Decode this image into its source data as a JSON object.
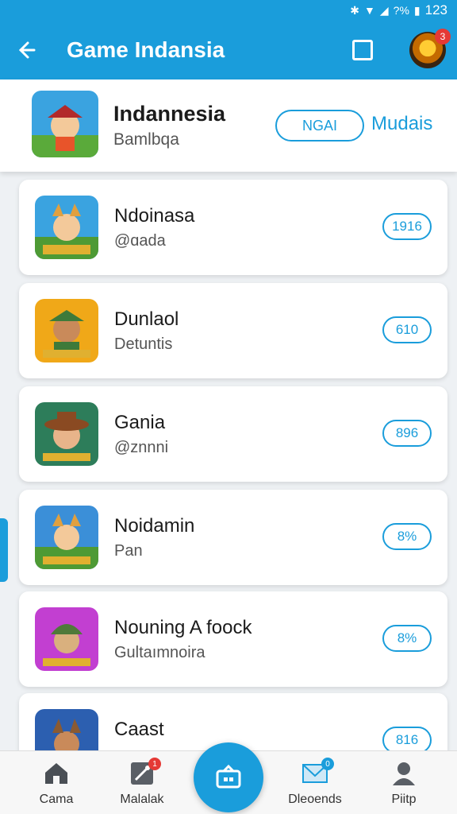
{
  "status_bar": {
    "time": "123",
    "battery": "?%"
  },
  "app_bar": {
    "title": "Game Indansia"
  },
  "avatar": {
    "badge": "3"
  },
  "header": {
    "title": "Indannesia",
    "subtitle": "Bamlbqa",
    "now_label": "NGAI",
    "action_label": "Mudais"
  },
  "items": [
    {
      "title": "Ndoinasa",
      "subtitle": "@ɑada",
      "value": "1916",
      "icon_bg": "#3aa3e0"
    },
    {
      "title": "Dunlaol",
      "subtitle": "Detuntis",
      "value": "610",
      "icon_bg": "#f0a818"
    },
    {
      "title": "Gania",
      "subtitle": "@znnni",
      "value": "896",
      "icon_bg": "#2d7d5a"
    },
    {
      "title": "Noidamin",
      "subtitle": "Pan",
      "value": "8%",
      "icon_bg": "#3b8fd8"
    },
    {
      "title": "Nouning A foock",
      "subtitle": "Gultaımnoira",
      "value": "8%",
      "icon_bg": "#c23fd1"
    },
    {
      "title": "Caast",
      "subtitle": "",
      "value": "816",
      "icon_bg": "#2c5fb0"
    }
  ],
  "nav": [
    {
      "label": "Cama",
      "icon": "home-icon"
    },
    {
      "label": "Malalak",
      "icon": "tools-icon",
      "badge": "1"
    },
    {
      "label": "Dleoends",
      "icon": "mail-icon",
      "badge": "0"
    },
    {
      "label": "Piitp",
      "icon": "profile-icon"
    }
  ],
  "colors": {
    "accent": "#1a9ddb",
    "badge": "#e53935"
  }
}
